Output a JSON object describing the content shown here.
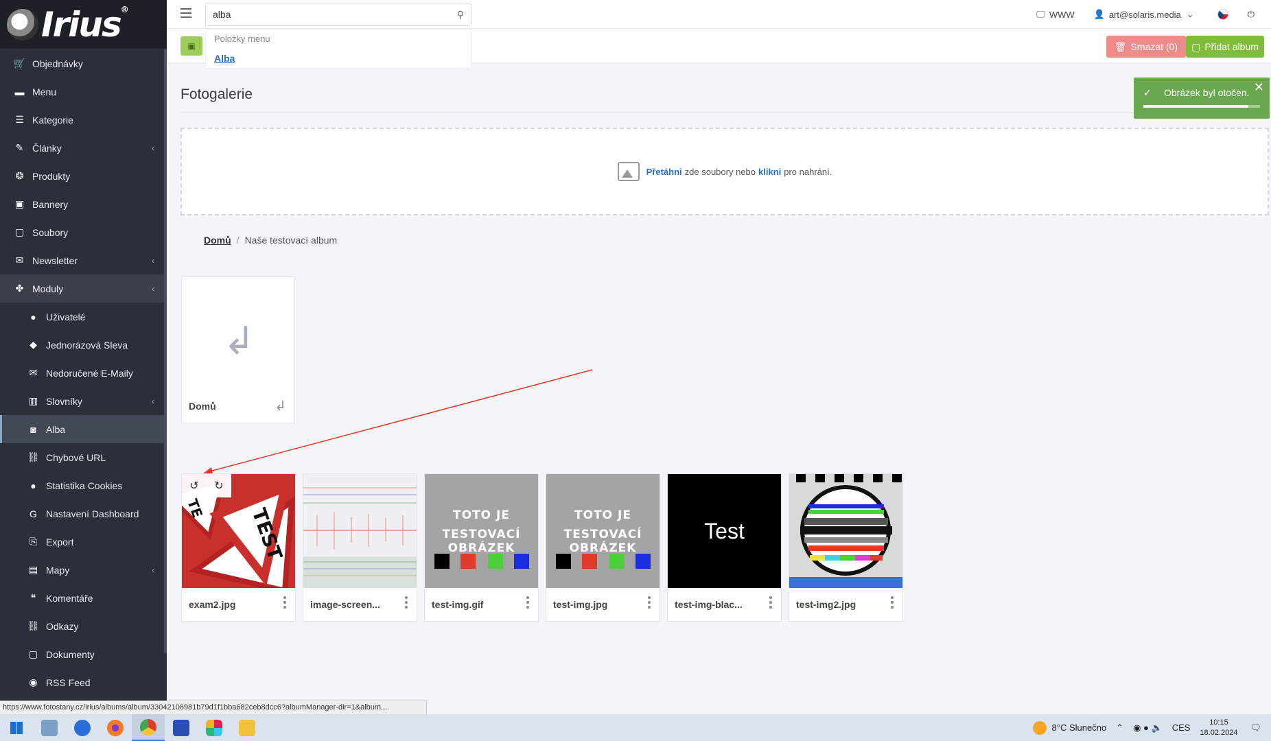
{
  "app": {
    "logo_text": "Irius"
  },
  "sidebar": {
    "items": [
      {
        "label": "Objednávky",
        "icon": "cart-icon",
        "glyph": "🛒",
        "chevron": false
      },
      {
        "label": "Menu",
        "icon": "folder-icon",
        "glyph": "▬",
        "chevron": false
      },
      {
        "label": "Kategorie",
        "icon": "list-icon",
        "glyph": "☰",
        "chevron": false
      },
      {
        "label": "Články",
        "icon": "pencil-icon",
        "glyph": "✎",
        "chevron": true
      },
      {
        "label": "Produkty",
        "icon": "cookie-icon",
        "glyph": "❂",
        "chevron": false
      },
      {
        "label": "Bannery",
        "icon": "image-icon",
        "glyph": "▣",
        "chevron": false
      },
      {
        "label": "Soubory",
        "icon": "file-icon",
        "glyph": "▢",
        "chevron": false
      },
      {
        "label": "Newsletter",
        "icon": "envelope-circle-icon",
        "glyph": "✉",
        "chevron": true
      },
      {
        "label": "Moduly",
        "icon": "puzzle-icon",
        "glyph": "✤",
        "chevron": true,
        "state": "active-parent"
      },
      {
        "label": "Uživatelé",
        "icon": "user-icon",
        "glyph": "●",
        "chevron": false,
        "sub": true
      },
      {
        "label": "Jednorázová Sleva",
        "icon": "tags-icon",
        "glyph": "◆",
        "chevron": false,
        "sub": true
      },
      {
        "label": "Nedoručené E-Maily",
        "icon": "envelope-x-icon",
        "glyph": "✉",
        "chevron": false,
        "sub": true
      },
      {
        "label": "Slovníky",
        "icon": "books-icon",
        "glyph": "▥",
        "chevron": true,
        "sub": true
      },
      {
        "label": "Alba",
        "icon": "camera-icon",
        "glyph": "◙",
        "chevron": false,
        "sub": true,
        "state": "active"
      },
      {
        "label": "Chybové URL",
        "icon": "link-icon",
        "glyph": "⛓",
        "chevron": false,
        "sub": true
      },
      {
        "label": "Statistika Cookies",
        "icon": "cookie-icon",
        "glyph": "●",
        "chevron": false,
        "sub": true
      },
      {
        "label": "Nastavení Dashboard",
        "icon": "google-icon",
        "glyph": "G",
        "chevron": false,
        "sub": true
      },
      {
        "label": "Export",
        "icon": "export-icon",
        "glyph": "⎘",
        "chevron": false,
        "sub": true
      },
      {
        "label": "Mapy",
        "icon": "map-icon",
        "glyph": "▤",
        "chevron": true,
        "sub": true
      },
      {
        "label": "Komentáře",
        "icon": "comments-icon",
        "glyph": "❝",
        "chevron": false,
        "sub": true
      },
      {
        "label": "Odkazy",
        "icon": "link-icon",
        "glyph": "⛓",
        "chevron": false,
        "sub": true
      },
      {
        "label": "Dokumenty",
        "icon": "documents-icon",
        "glyph": "▢",
        "chevron": false,
        "sub": true
      },
      {
        "label": "RSS Feed",
        "icon": "rss-icon",
        "glyph": "◉",
        "chevron": false,
        "sub": true
      }
    ]
  },
  "topbar": {
    "search_value": "alba",
    "dropdown_category": "Položky menu",
    "dropdown_result": "Alba",
    "www_label": "WWW",
    "user_email": "art@solaris.media"
  },
  "toolbar": {
    "delete_label": "Smazat (0)",
    "add_label": "Přidat album"
  },
  "main": {
    "title": "Fotogalerie",
    "dropzone": {
      "drag": "Přetáhni",
      "middle": "zde soubory nebo",
      "click": "klikni",
      "end": "pro nahrání."
    },
    "breadcrumb": {
      "home": "Domů",
      "sep": "/",
      "current": "Naše testovací album"
    },
    "folder": {
      "name": "Domů"
    },
    "thumbnails": [
      {
        "name": "exam2.jpg",
        "kind": "warning-sign"
      },
      {
        "name": "image-screen...",
        "kind": "screenshot"
      },
      {
        "name": "test-img.gif",
        "kind": "gray-test",
        "line1": "TOTO JE",
        "line2": "TESTOVACÍ OBRÁZEK"
      },
      {
        "name": "test-img.jpg",
        "kind": "gray-test",
        "line1": "TOTO JE",
        "line2": "TESTOVACÍ OBRÁZEK"
      },
      {
        "name": "test-img-blac...",
        "kind": "black-test",
        "text": "Test"
      },
      {
        "name": "test-img2.jpg",
        "kind": "test-card"
      }
    ],
    "swatch_colors": [
      "#000000",
      "#e03a2a",
      "#4ccf3a",
      "#1a2ee0"
    ]
  },
  "toast": {
    "message": "Obrázek byl otočen.",
    "progress": 0.9
  },
  "status_url": "https://www.fotostany.cz/irius/albums/album/33042108981b79d1f1bba682ceb8dcc6?albumManager-dir=1&album...",
  "taskbar": {
    "weather": "8°C  Slunečno",
    "lang": "CES",
    "time": "10:15",
    "date": "18.02.2024"
  }
}
